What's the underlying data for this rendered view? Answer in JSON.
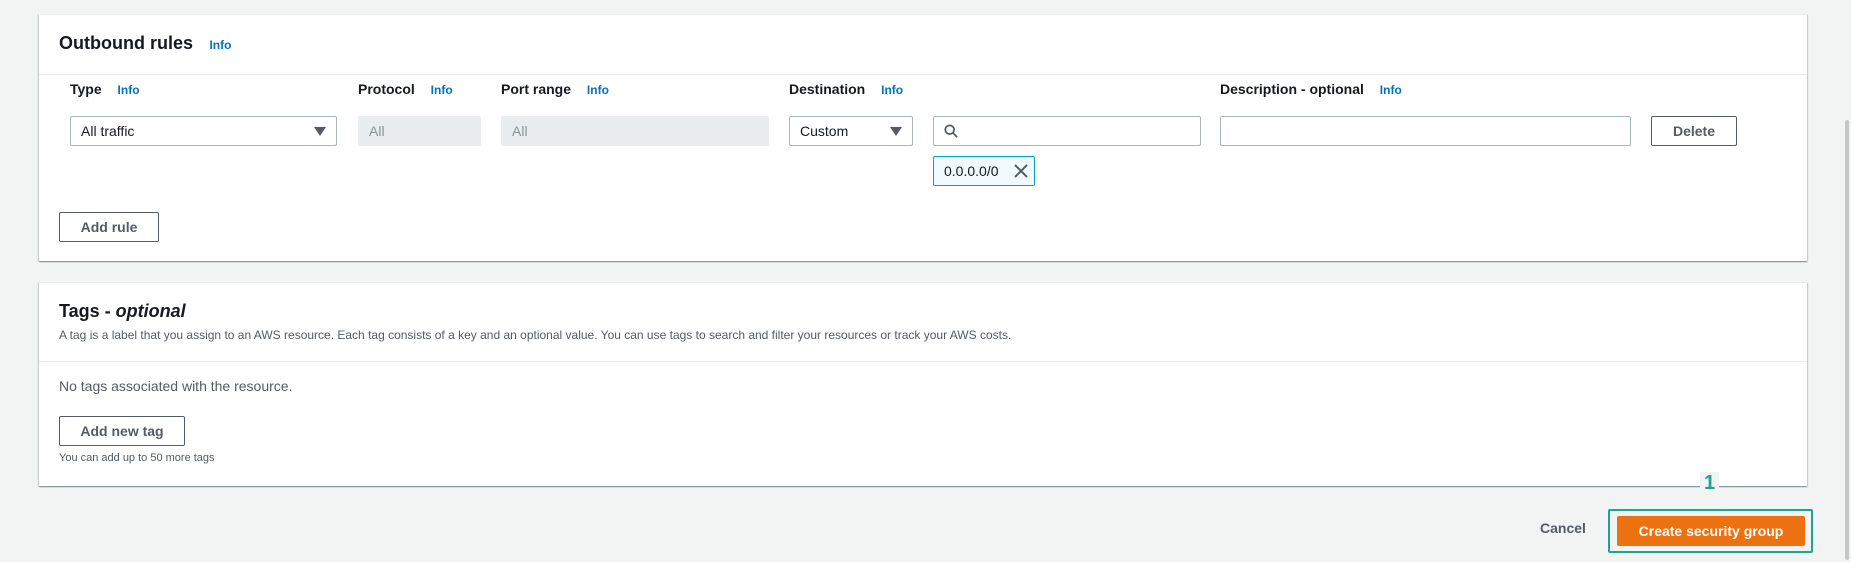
{
  "outbound": {
    "title": "Outbound rules",
    "info": "Info",
    "columns": {
      "type": "Type",
      "protocol": "Protocol",
      "port_range": "Port range",
      "destination": "Destination",
      "description": "Description - optional"
    },
    "rule": {
      "type_value": "All traffic",
      "protocol_value": "All",
      "port_range_value": "All",
      "destination_mode": "Custom",
      "destination_search_value": "",
      "description_value": "",
      "delete_label": "Delete",
      "destination_tokens": [
        "0.0.0.0/0"
      ]
    },
    "add_rule_label": "Add rule"
  },
  "tags": {
    "title_main": "Tags - ",
    "title_optional": "optional",
    "description": "A tag is a label that you assign to an AWS resource. Each tag consists of a key and an optional value. You can use tags to search and filter your resources or track your AWS costs.",
    "empty_message": "No tags associated with the resource.",
    "add_tag_label": "Add new tag",
    "limit_note": "You can add up to 50 more tags"
  },
  "footer": {
    "cancel_label": "Cancel",
    "create_label": "Create security group",
    "step_marker": "1"
  },
  "colors": {
    "primary": "#ec7211",
    "link": "#0073bb",
    "highlight": "#1fa58a"
  },
  "icons": {
    "search": "search-icon",
    "close": "close-icon",
    "caret": "caret-down-icon"
  }
}
